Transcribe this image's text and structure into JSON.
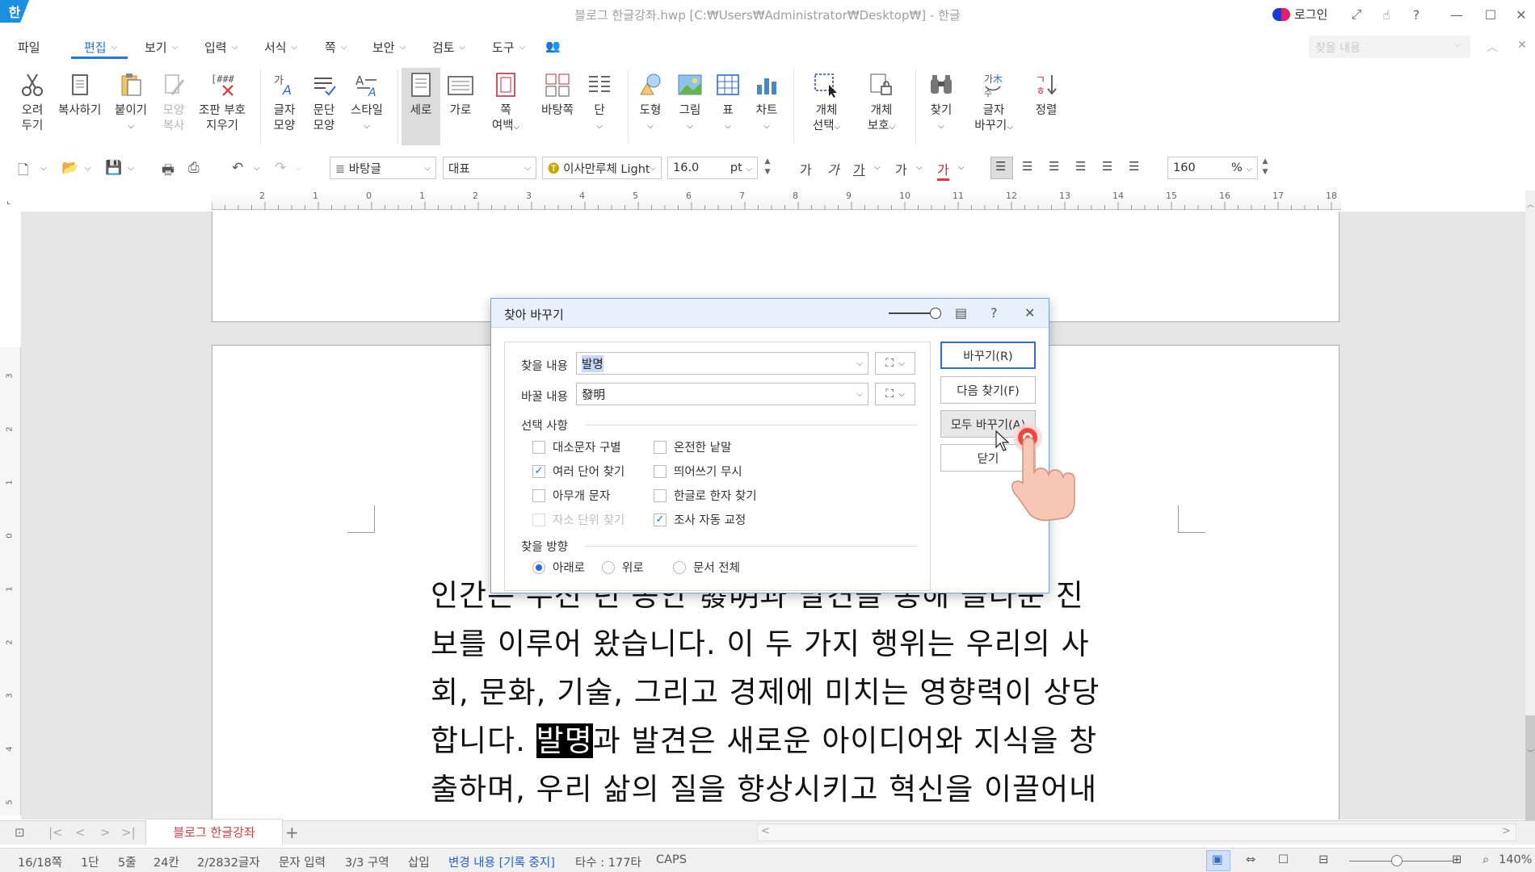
{
  "window": {
    "logo": "한",
    "title": "블로그 한글강좌.hwp [C:₩Users₩Administrator₩Desktop₩] - 한글",
    "login": "로그인"
  },
  "menu": {
    "items": [
      "파일",
      "편집",
      "보기",
      "입력",
      "서식",
      "쪽",
      "보안",
      "검토",
      "도구"
    ],
    "active": "편집",
    "find_placeholder": "찾을 내용"
  },
  "ribbon": {
    "cut": [
      "오려",
      "두기"
    ],
    "copy": [
      "복사하기"
    ],
    "paste": [
      "붙이기"
    ],
    "format_copy": [
      "모양",
      "복사"
    ],
    "clear_codes": [
      "조판 부호",
      "지우기"
    ],
    "char_shape": [
      "글자",
      "모양"
    ],
    "para_shape": [
      "문단",
      "모양"
    ],
    "style": [
      "스타일"
    ],
    "portrait": [
      "세로"
    ],
    "landscape": [
      "가로"
    ],
    "margins": [
      "쪽",
      "여백"
    ],
    "background": [
      "바탕쪽"
    ],
    "columns": [
      "단"
    ],
    "shape": [
      "도형"
    ],
    "picture": [
      "그림"
    ],
    "table": [
      "표"
    ],
    "chart": [
      "차트"
    ],
    "obj_select": [
      "개체",
      "선택"
    ],
    "obj_protect": [
      "개체",
      "보호"
    ],
    "find": [
      "찾기"
    ],
    "replace": [
      "글자",
      "바꾸기"
    ],
    "sort": [
      "정렬"
    ]
  },
  "toolbar": {
    "style_name": "바탕글",
    "language": "대표",
    "font_name": "이사만루체 Light",
    "font_size": "16.0",
    "font_unit": "pt",
    "zoom": "160",
    "zoom_unit": "%"
  },
  "ruler": {
    "marks": [
      "2",
      "1",
      "0",
      "1",
      "2",
      "3",
      "4",
      "5",
      "6",
      "7",
      "8",
      "9",
      "10",
      "11",
      "12",
      "13",
      "14",
      "15",
      "16",
      "17",
      "18"
    ]
  },
  "vruler": {
    "marks": [
      "3",
      "2",
      "1",
      "0",
      "1",
      "2",
      "3",
      "4",
      "5"
    ]
  },
  "document": {
    "lines": [
      "인간은 수천 년 동안 發明과 발견을 통해 놀라운 진",
      "보를 이루어 왔습니다. 이 두 가지 행위는 우리의 사",
      "회, 문화, 기술, 그리고 경제에 미치는 영향력이 상당",
      "합니다.",
      "과 발견은 새로운 아이디어와 지식을 창",
      "출하며, 우리 삶의 질을 향상시키고 혁신을 이끌어내"
    ],
    "highlighted_word": "발명"
  },
  "dialog": {
    "title": "찾아 바꾸기",
    "find_label": "찾을 내용",
    "find_value": "발명",
    "replace_label": "바꿀 내용",
    "replace_value": "發明",
    "options_header": "선택 사항",
    "options": [
      {
        "label": "대소문자 구별",
        "checked": false,
        "enabled": true
      },
      {
        "label": "온전한 낱말",
        "checked": false,
        "enabled": true
      },
      {
        "label": "여러 단어 찾기",
        "checked": true,
        "enabled": true
      },
      {
        "label": "띄어쓰기 무시",
        "checked": false,
        "enabled": true
      },
      {
        "label": "아무개 문자",
        "checked": false,
        "enabled": true
      },
      {
        "label": "한글로 한자 찾기",
        "checked": false,
        "enabled": true
      },
      {
        "label": "자소 단위 찾기",
        "checked": false,
        "enabled": false
      },
      {
        "label": "조사 자동 교정",
        "checked": true,
        "enabled": true
      }
    ],
    "direction_header": "찾을 방향",
    "directions": [
      {
        "label": "아래로",
        "selected": true
      },
      {
        "label": "위로",
        "selected": false
      },
      {
        "label": "문서 전체",
        "selected": false
      }
    ],
    "buttons": {
      "replace": "바꾸기(R)",
      "find_next": "다음 찾기(F)",
      "replace_all": "모두 바꾸기(A)",
      "close": "닫기"
    }
  },
  "tabs": {
    "document_tab": "블로그 한글강좌",
    "add": "+"
  },
  "status": {
    "page": "16/18쪽",
    "column": "1단",
    "line": "5줄",
    "char_pos": "24칸",
    "chars": "2/2832글자",
    "input_mode": "문자 입력",
    "section": "3/3 구역",
    "insert": "삽입",
    "track_changes": "변경 내용 [기록 중지]",
    "typing_speed": "타수 : 177타",
    "caps": "CAPS",
    "zoom": "140%"
  },
  "colors": {
    "accent": "#1d7be0",
    "tab_text": "#d23c3c",
    "dialog_title_bg": "#e8f0fc"
  }
}
